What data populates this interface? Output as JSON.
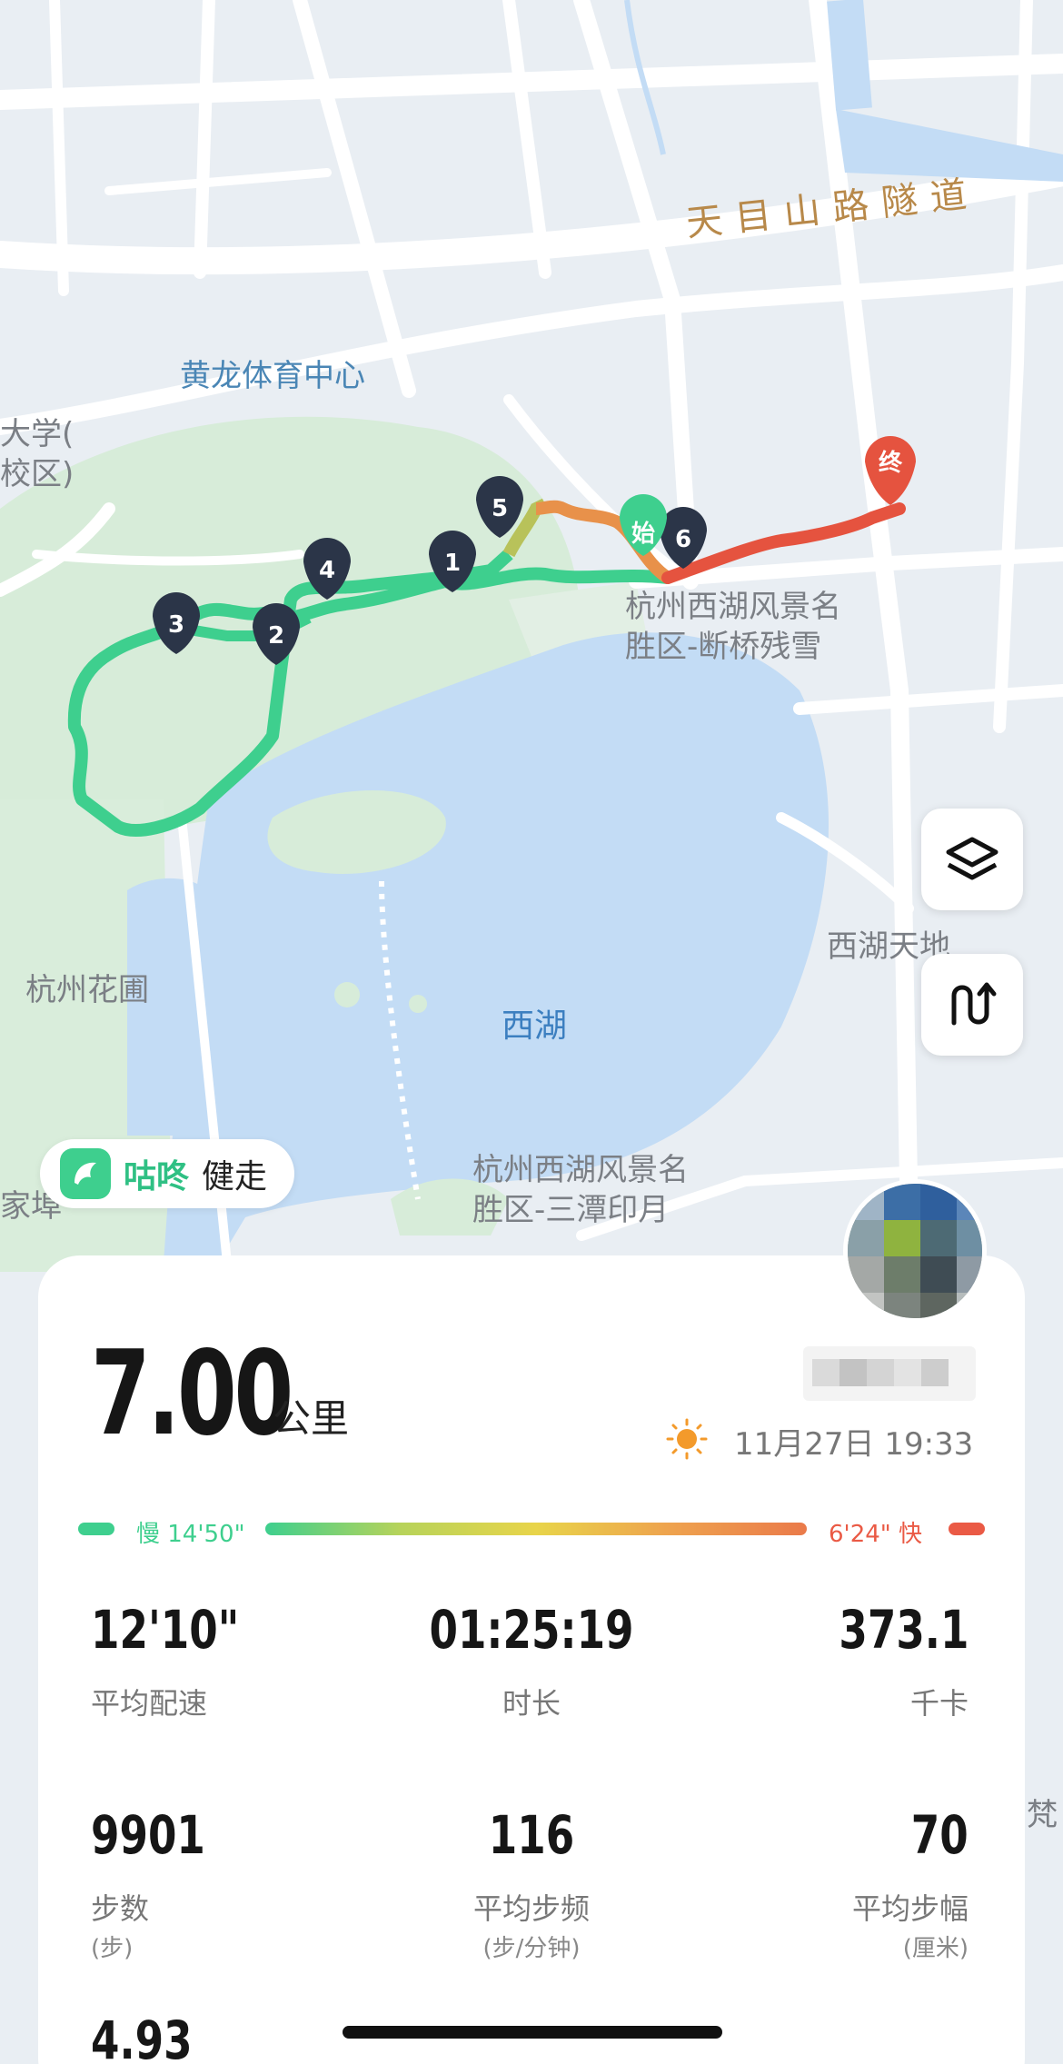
{
  "map": {
    "road_label": "天目山路隧道",
    "poi_labels": {
      "huanglong": "黄龙体育中心",
      "univ": "大学(\n校区)",
      "duanqiao": "杭州西湖风景名\n胜区-断桥残雪",
      "xihu_tiandi": "西湖天地",
      "huapu": "杭州花圃",
      "santan": "杭州西湖风景名\n胜区-三潭印月",
      "jiawu": "家埠",
      "fan": "梵"
    },
    "lake_label": "西湖",
    "markers": [
      "1",
      "2",
      "3",
      "4",
      "5",
      "6"
    ],
    "start_label": "始",
    "end_label": "终",
    "buttons": {
      "layers": "layers-icon",
      "route": "route-icon"
    }
  },
  "brand": {
    "name": "咕咚",
    "sport": "健走"
  },
  "summary": {
    "distance": "7.00",
    "distance_unit": "公里",
    "date_time": "11月27日 19:33",
    "weather_icon": "sun-icon"
  },
  "pace_legend": {
    "slow": "慢 14'50\"",
    "fast": "6'24\" 快",
    "slow_color": "#3ecf8e",
    "fast_color": "#ea5a45"
  },
  "stats": [
    {
      "value": "12'10\"",
      "label": "平均配速",
      "sub": ""
    },
    {
      "value": "01:25:19",
      "label": "时长",
      "sub": ""
    },
    {
      "value": "373.1",
      "label": "千卡",
      "sub": ""
    },
    {
      "value": "9901",
      "label": "步数",
      "sub": "(步)"
    },
    {
      "value": "116",
      "label": "平均步频",
      "sub": "(步/分钟)"
    },
    {
      "value": "70",
      "label": "平均步幅",
      "sub": "(厘米)"
    },
    {
      "value": "4.93",
      "label": "",
      "sub": ""
    }
  ],
  "colors": {
    "route_green": "#3ecf8e",
    "route_orange": "#e8914a",
    "route_red": "#e5533f",
    "marker": "#2b3548"
  }
}
